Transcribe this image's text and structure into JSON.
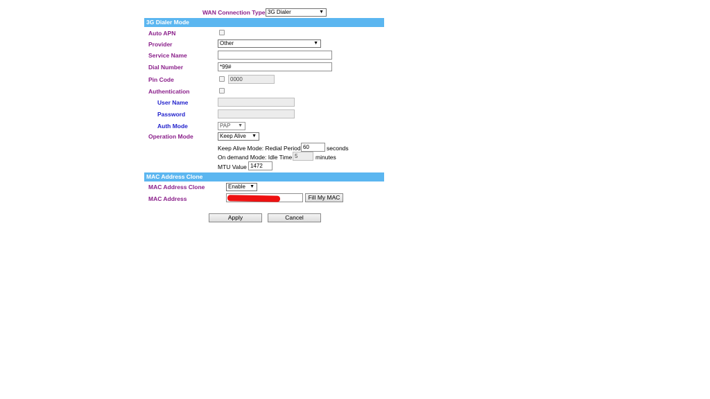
{
  "wan": {
    "label": "WAN Connection Type",
    "value": "3G Dialer"
  },
  "dialer_section": {
    "title": "3G Dialer Mode",
    "auto_apn_label": "Auto APN",
    "provider_label": "Provider",
    "provider_value": "Other",
    "service_name_label": "Service Name",
    "service_name_value": "",
    "dial_number_label": "Dial Number",
    "dial_number_value": "*99#",
    "pin_code_label": "Pin Code",
    "pin_code_value": "0000",
    "authentication_label": "Authentication",
    "user_name_label": "User Name",
    "password_label": "Password",
    "auth_mode_label": "Auth Mode",
    "auth_mode_value": "PAP",
    "operation_mode_label": "Operation Mode",
    "operation_mode_value": "Keep Alive",
    "keep_alive_text": "Keep Alive Mode: Redial Period",
    "keep_alive_value": "60",
    "keep_alive_unit": "seconds",
    "on_demand_text": "On demand Mode: Idle Time",
    "on_demand_value": "5",
    "on_demand_unit": "minutes",
    "mtu_label": "MTU Value",
    "mtu_value": "1472"
  },
  "mac_section": {
    "title": "MAC Address Clone",
    "clone_label": "MAC Address Clone",
    "clone_value": "Enable",
    "address_label": "MAC Address",
    "fill_button": "Fill My MAC"
  },
  "actions": {
    "apply": "Apply",
    "cancel": "Cancel"
  },
  "colors": {
    "section_bar": "#5bb6f0",
    "label_purple": "#8a1f8a",
    "label_blue": "#2222cc",
    "redaction": "#ee1111"
  }
}
